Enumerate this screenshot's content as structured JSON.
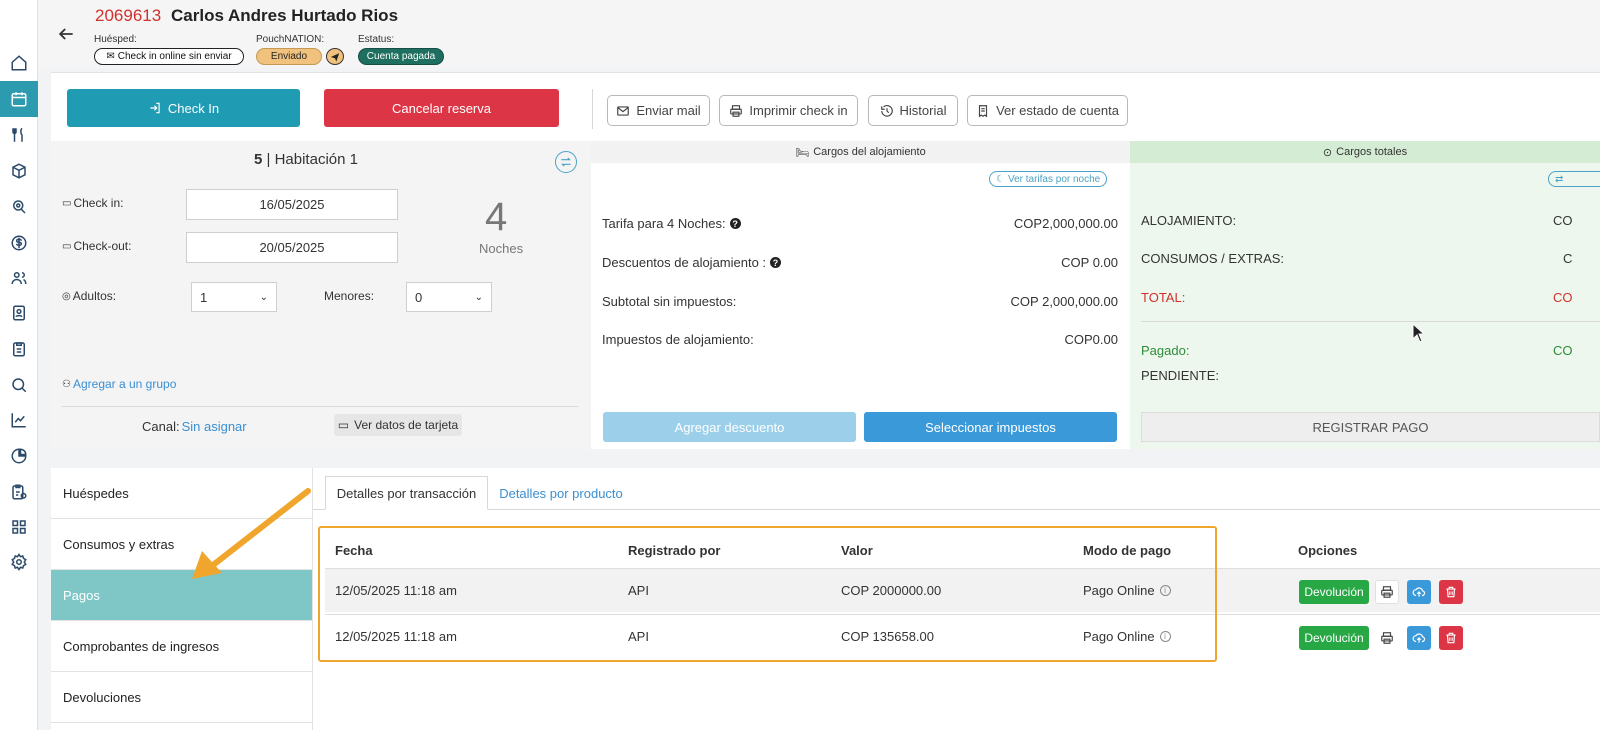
{
  "sidebar": {
    "icons": [
      "home-icon",
      "calendar-icon",
      "restaurant-icon",
      "box-icon",
      "search-location-icon",
      "dollar-icon",
      "users-icon",
      "contacts-icon",
      "clipboard-icon",
      "search-icon",
      "chart-line-icon",
      "pie-chart-icon",
      "report-icon",
      "apps-icon",
      "settings-icon"
    ],
    "active_index": 1
  },
  "header": {
    "reservation_number": "2069613",
    "guest_name": "Carlos Andres Hurtado Rios",
    "huesped_label": "Huésped:",
    "huesped_status": "Check in online sin enviar",
    "pouch_label": "PouchNATION:",
    "pouch_status": "Enviado",
    "estatus_label": "Estatus:",
    "estatus_value": "Cuenta pagada"
  },
  "actions": {
    "checkin": "Check In",
    "cancel": "Cancelar reserva",
    "mail": "Enviar mail",
    "print": "Imprimir check in",
    "history": "Historial",
    "account": "Ver estado de cuenta"
  },
  "booking": {
    "room_number": "5",
    "room_name": "| Habitación 1",
    "checkin_label": "Check in:",
    "checkin_value": "16/05/2025",
    "checkout_label": "Check-out:",
    "checkout_value": "20/05/2025",
    "nights_value": "4",
    "nights_label": "Noches",
    "adults_label": "Adultos:",
    "adults_value": "1",
    "minors_label": "Menores:",
    "minors_value": "0",
    "group_link": "Agregar a un grupo",
    "canal_label": "Canal:",
    "canal_value": "Sin asignar",
    "card_button": "Ver datos de tarjeta"
  },
  "cargos": {
    "title": "Cargos del alojamiento",
    "rates_link": "Ver tarifas por noche",
    "rows": [
      {
        "label": "Tarifa para 4 Noches:",
        "value": "COP2,000,000.00"
      },
      {
        "label": "Descuentos de alojamiento :",
        "value": "COP 0.00"
      },
      {
        "label": "Subtotal sin impuestos:",
        "value": "COP 2,000,000.00"
      },
      {
        "label": "Impuestos de alojamiento:",
        "value": "COP0.00"
      }
    ],
    "discount_button": "Agregar descuento",
    "tax_button": "Seleccionar impuestos"
  },
  "totales": {
    "title": "Cargos totales",
    "alojamiento_label": "ALOJAMIENTO:",
    "alojamiento_value": "CO",
    "consumos_label": "CONSUMOS / EXTRAS:",
    "consumos_value": "C",
    "total_label": "TOTAL:",
    "total_value": "CO",
    "pagado_label": "Pagado:",
    "pagado_value": "CO",
    "pendiente_label": "PENDIENTE:",
    "register_button": "REGISTRAR PAGO"
  },
  "left_menu": {
    "items": [
      "Huéspedes",
      "Consumos y extras",
      "Pagos",
      "Comprobantes de ingresos",
      "Devoluciones"
    ],
    "active_index": 2
  },
  "tabs": {
    "transaction": "Detalles por transacción",
    "product": "Detalles por producto"
  },
  "table": {
    "headers": [
      "Fecha",
      "Registrado por",
      "Valor",
      "Modo de pago",
      "Opciones"
    ],
    "rows": [
      {
        "fecha": "12/05/2025 11:18 am",
        "registrado": "API",
        "valor": "COP 2000000.00",
        "modo": "Pago Online",
        "refund": "Devolución"
      },
      {
        "fecha": "12/05/2025 11:18 am",
        "registrado": "API",
        "valor": "COP 135658.00",
        "modo": "Pago Online",
        "refund": "Devolución"
      }
    ]
  },
  "colors": {
    "accent": "#1f9bb4",
    "danger": "#dc3545",
    "success": "#28a745",
    "highlight": "#f0a52c"
  }
}
